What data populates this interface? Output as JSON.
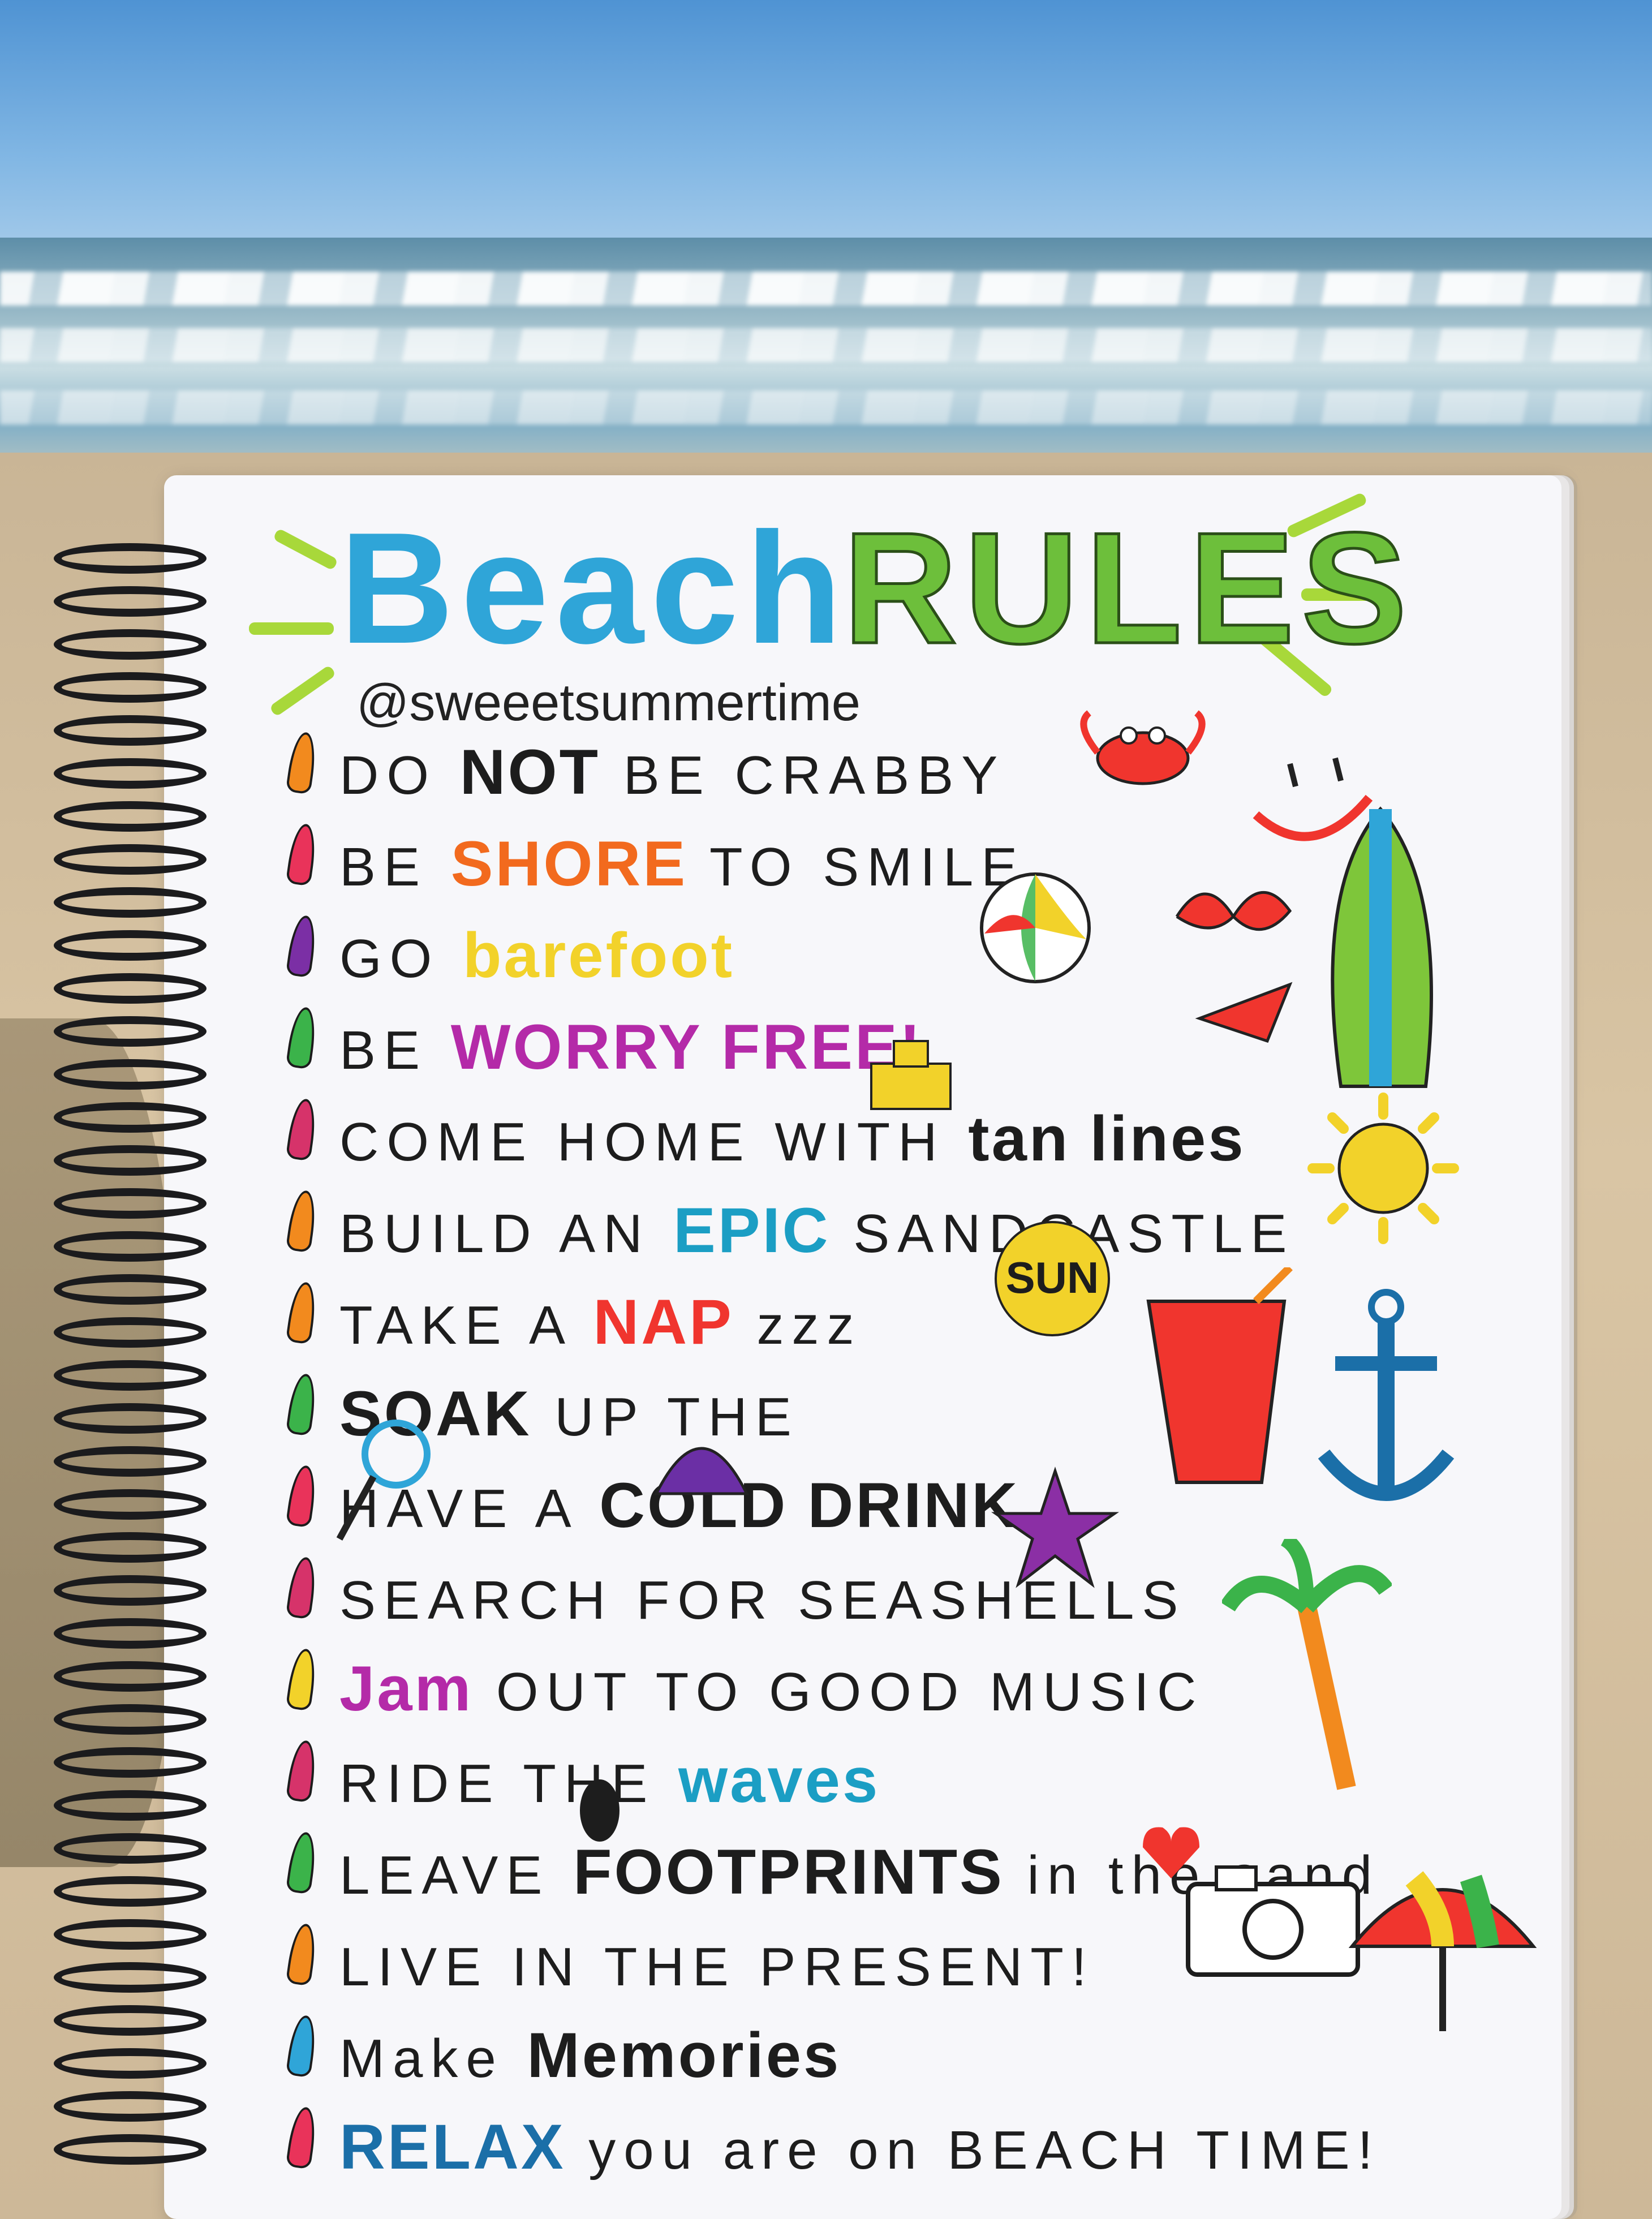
{
  "notebook": {
    "title_part1": "Beach",
    "title_part2": "RULES",
    "handle": "@sweeetsummertime",
    "rules": [
      {
        "lead": "DO ",
        "hl": "NOT",
        "tail": " BE CRABBY",
        "hl_color": "#1d1d1d",
        "bullet": "#f28a1e"
      },
      {
        "lead": "BE ",
        "hl": "SHORE",
        "tail": " TO SMILE",
        "hl_color": "#f26a1e",
        "bullet": "#e9335a"
      },
      {
        "lead": "GO ",
        "hl": "barefoot",
        "tail": "",
        "hl_color": "#f2d22a",
        "bullet": "#7b2fa5"
      },
      {
        "lead": "BE ",
        "hl": "WORRY FREE!",
        "tail": "",
        "hl_color": "#b42aa8",
        "bullet": "#3bb34a"
      },
      {
        "lead": "COME HOME WITH ",
        "hl": "tan lines",
        "tail": "",
        "hl_color": "#1d1d1d",
        "bullet": "#d6336a"
      },
      {
        "lead": "BUILD AN ",
        "hl": "EPIC",
        "tail": " SANDCASTLE",
        "hl_color": "#1b9ec4",
        "bullet": "#f28a1e"
      },
      {
        "lead": "TAKE A ",
        "hl": "NAP",
        "tail": " zzz",
        "hl_color": "#f0352e",
        "bullet": "#f28a1e"
      },
      {
        "lead": "",
        "hl": "SOAK",
        "tail": " UP THE",
        "hl_color": "#1d1d1d",
        "bullet": "#3bb34a"
      },
      {
        "lead": "HAVE A ",
        "hl": "COLD DRINK",
        "tail": "",
        "hl_color": "#1d1d1d",
        "bullet": "#e9335a"
      },
      {
        "lead": "SEARCH FOR ",
        "hl": "",
        "tail": "SEASHELLS",
        "hl_color": "#1d1d1d",
        "bullet": "#d6336a"
      },
      {
        "lead": "",
        "hl": "Jam",
        "tail": " OUT TO GOOD MUSIC",
        "hl_color": "#b42aa8",
        "bullet": "#f2d22a"
      },
      {
        "lead": "RIDE THE ",
        "hl": "waves",
        "tail": "",
        "hl_color": "#1b9ec4",
        "bullet": "#d6336a"
      },
      {
        "lead": "LEAVE ",
        "hl": "FOOTPRINTS",
        "tail": " in the sand",
        "hl_color": "#1d1d1d",
        "bullet": "#3bb34a"
      },
      {
        "lead": "LIVE IN THE PRESENT!",
        "hl": "",
        "tail": "",
        "hl_color": "#1d1d1d",
        "bullet": "#f28a1e"
      },
      {
        "lead": "Make ",
        "hl": "Memories",
        "tail": "",
        "hl_color": "#1d1d1d",
        "bullet": "#2fa5d8"
      },
      {
        "lead": "",
        "hl": "RELAX",
        "tail": " you are on BEACH TIME!",
        "hl_color": "#1b6fa8",
        "bullet": "#e9335a"
      }
    ],
    "sun_word": "SUN",
    "colors": {
      "title_blue": "#2fa5d8",
      "title_green": "#6dbf3b",
      "ray_green": "#a8d83a",
      "sky": "#4f93d3",
      "sand": "#d9c5a4"
    },
    "icons": [
      "crab-icon",
      "smiley-icon",
      "beach-ball-icon",
      "bikini-icon",
      "surfboard-icon",
      "sandcastle-icon",
      "sun-icon",
      "drink-icon",
      "anchor-icon",
      "magnifier-icon",
      "seashell-icon",
      "starfish-icon",
      "palm-tree-icon",
      "footprint-icon",
      "heart-icon",
      "camera-icon",
      "umbrella-icon"
    ]
  }
}
